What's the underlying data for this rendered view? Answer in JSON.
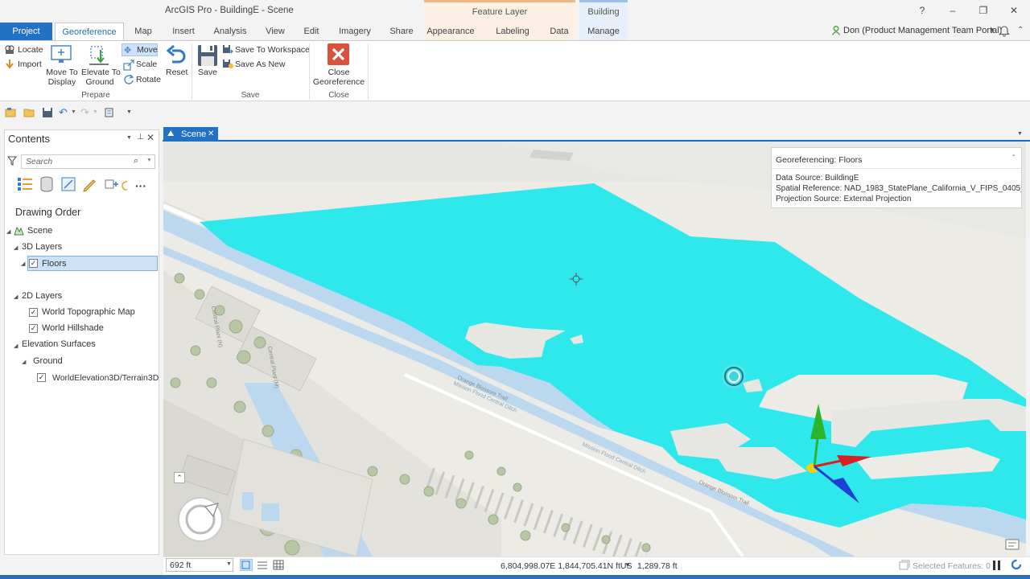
{
  "window": {
    "title": "ArcGIS Pro - BuildingE - Scene",
    "help": "?",
    "minimize": "–",
    "maximize": "❐",
    "close": "✕"
  },
  "contextual_tabs": {
    "feature_layer": "Feature Layer",
    "building": "Building"
  },
  "tabs": [
    "Project",
    "Georeference",
    "Map",
    "Insert",
    "Analysis",
    "View",
    "Edit",
    "Imagery",
    "Share",
    "Appearance",
    "Labeling",
    "Data",
    "Manage"
  ],
  "user": "Don (Product Management Team Portal)",
  "ribbon": {
    "prepare": {
      "locate": "Locate",
      "import": "Import",
      "move_to_display_1": "Move To",
      "move_to_display_2": "Display",
      "elevate_1": "Elevate To",
      "elevate_2": "Ground",
      "move": "Move",
      "scale": "Scale",
      "rotate": "Rotate",
      "reset": "Reset",
      "group": "Prepare"
    },
    "save": {
      "save": "Save",
      "save_to_workspace": "Save To Workspace",
      "save_as_new": "Save As New",
      "group": "Save"
    },
    "close": {
      "close_1": "Close",
      "close_2": "Georeference",
      "group": "Close"
    }
  },
  "contents": {
    "title": "Contents",
    "search_placeholder": "Search",
    "drawing_order": "Drawing Order",
    "scene": "Scene",
    "layers_3d": "3D Layers",
    "floors": "Floors",
    "layers_2d": "2D Layers",
    "topo": "World Topographic Map",
    "hillshade": "World Hillshade",
    "elevation_surfaces": "Elevation Surfaces",
    "ground": "Ground",
    "world_elevation": "WorldElevation3D/Terrain3D"
  },
  "scene_tab": "Scene",
  "info": {
    "title": "Georeferencing: Floors",
    "data_source": "Data Source: BuildingE",
    "spatial_reference": "Spatial Reference: NAD_1983_StatePlane_California_V_FIPS_0405_Feet",
    "projection_source": "Projection Source: External Projection"
  },
  "map_labels": {
    "road_1": "Orange Blossom Trail",
    "road_2": "Orange Blossom Trail",
    "ditch_1": "Mission Flood Central Ditch",
    "ditch_2": "Mission Flood Central Ditch",
    "plant_1": "Central Plant (N)",
    "plant_2": "Central Plant (M)"
  },
  "status": {
    "scale": "692 ft",
    "coordinates": "6,804,998.07E 1,844,705.41N ftUS",
    "elevation": "1,289.78 ft",
    "selected": "Selected Features: 0"
  },
  "colors": {
    "accent": "#2271c5",
    "floors_fill": "#2ee8ec",
    "feature_layer_ctx": "#fcefe4",
    "building_ctx": "#e7effa"
  }
}
